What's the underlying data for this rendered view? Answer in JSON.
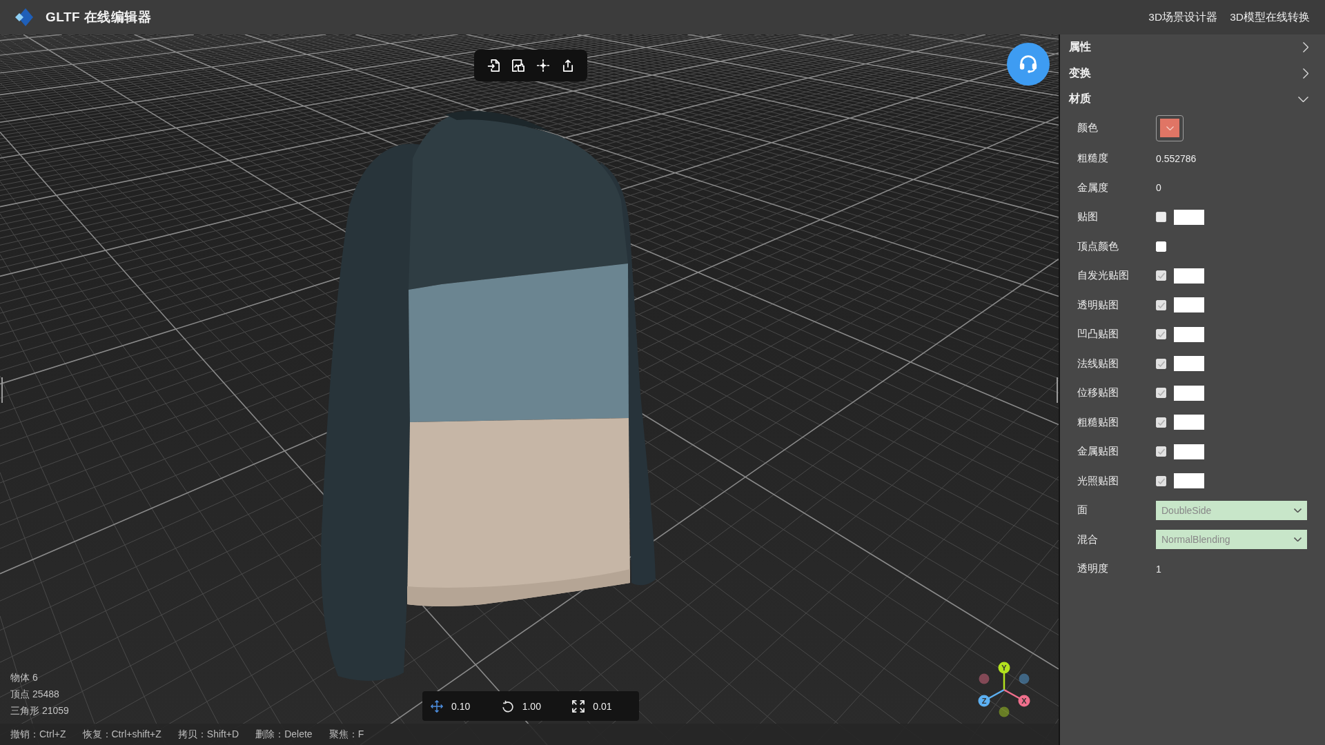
{
  "header": {
    "title": "GLTF 在线编辑器",
    "links": [
      "3D场景设计器",
      "3D模型在线转换"
    ]
  },
  "viewport": {
    "stats": [
      "物体 6",
      "顶点 25488",
      "三角形 21059"
    ],
    "tools": [
      {
        "kind": "translate",
        "value": "0.10",
        "selected": true
      },
      {
        "kind": "rotate",
        "value": "1.00",
        "selected": false
      },
      {
        "kind": "scale",
        "value": "0.01",
        "selected": false
      }
    ],
    "axes": [
      {
        "label": "Y",
        "color": "#b3e21e"
      },
      {
        "label": "Z",
        "color": "#5cb0f2"
      },
      {
        "label": "X",
        "color": "#f06f8c"
      }
    ],
    "shortcuts": [
      "撤销：Ctrl+Z",
      "恢复：Ctrl+shift+Z",
      "拷贝：Shift+D",
      "删除：Delete",
      "聚焦：F"
    ]
  },
  "panel": {
    "sections": [
      {
        "title": "属性",
        "expanded": false
      },
      {
        "title": "变换",
        "expanded": false
      },
      {
        "title": "材质",
        "expanded": true,
        "rows": [
          {
            "kind": "color",
            "label": "颜色",
            "color": "#e07565"
          },
          {
            "kind": "number",
            "label": "粗糙度",
            "value": "0.552786"
          },
          {
            "kind": "number",
            "label": "金属度",
            "value": "0"
          },
          {
            "kind": "map",
            "label": "贴图",
            "checked": false,
            "disabled": true
          },
          {
            "kind": "checkbox",
            "label": "顶点颜色",
            "checked": false,
            "disabled": false
          },
          {
            "kind": "map",
            "label": "自发光贴图",
            "checked": true,
            "disabled": true
          },
          {
            "kind": "map",
            "label": "透明贴图",
            "checked": true,
            "disabled": true
          },
          {
            "kind": "map",
            "label": "凹凸贴图",
            "checked": true,
            "disabled": true
          },
          {
            "kind": "map",
            "label": "法线贴图",
            "checked": true,
            "disabled": true
          },
          {
            "kind": "map",
            "label": "位移贴图",
            "checked": true,
            "disabled": true
          },
          {
            "kind": "map",
            "label": "粗糙贴图",
            "checked": true,
            "disabled": true
          },
          {
            "kind": "map",
            "label": "金属贴图",
            "checked": true,
            "disabled": true
          },
          {
            "kind": "map",
            "label": "光照贴图",
            "checked": true,
            "disabled": true
          },
          {
            "kind": "select",
            "label": "面",
            "value": "DoubleSide"
          },
          {
            "kind": "select",
            "label": "混合",
            "value": "NormalBlending"
          },
          {
            "kind": "number",
            "label": "透明度",
            "value": "1"
          }
        ]
      }
    ]
  }
}
